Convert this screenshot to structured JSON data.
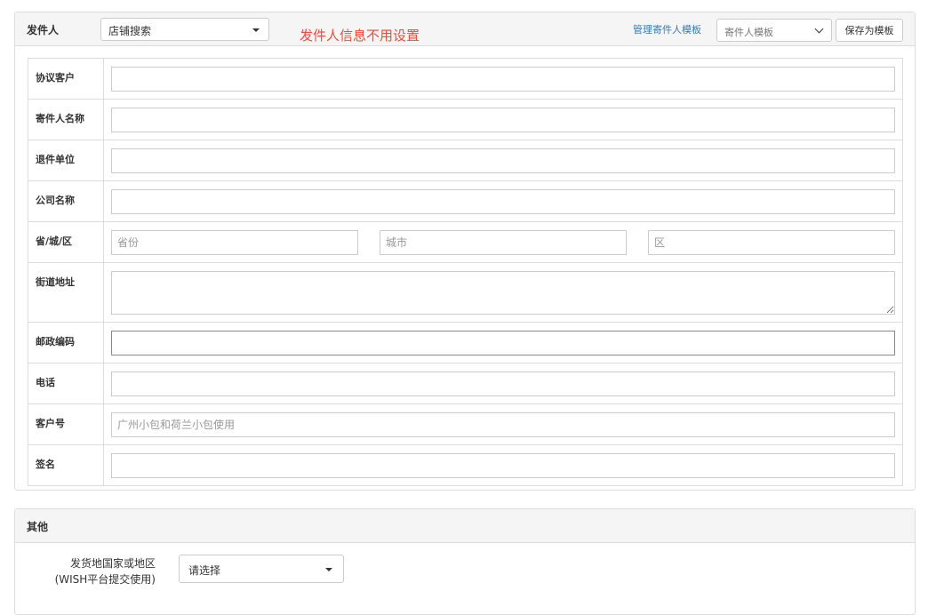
{
  "sender_panel": {
    "title": "发件人",
    "shop_select": "店铺搜索",
    "note": "发件人信息不用设置",
    "manage_link": "管理寄件人模板",
    "template_select": "寄件人模板",
    "save_button": "保存为模板",
    "fields": {
      "agreement_customer": {
        "label": "协议客户",
        "value": ""
      },
      "sender_name": {
        "label": "寄件人名称",
        "value": ""
      },
      "return_unit": {
        "label": "退件单位",
        "value": ""
      },
      "company_name": {
        "label": "公司名称",
        "value": ""
      },
      "region": {
        "label": "省/城/区",
        "province_placeholder": "省份",
        "city_placeholder": "城市",
        "district_placeholder": "区"
      },
      "street_address": {
        "label": "街道地址",
        "value": ""
      },
      "postcode": {
        "label": "邮政编码",
        "value": ""
      },
      "phone": {
        "label": "电话",
        "value": ""
      },
      "customer_no": {
        "label": "客户号",
        "placeholder": "广州小包和荷兰小包使用"
      },
      "signature": {
        "label": "签名",
        "value": ""
      }
    }
  },
  "other_panel": {
    "title": "其他",
    "country_label_line1": "发货地国家或地区",
    "country_label_line2": "(WISH平台提交使用)",
    "country_select": "请选择"
  },
  "colors": {
    "note_red": "#e74c3c",
    "link_blue": "#337ab7",
    "border": "#dddddd",
    "heading_bg": "#f5f5f5"
  }
}
